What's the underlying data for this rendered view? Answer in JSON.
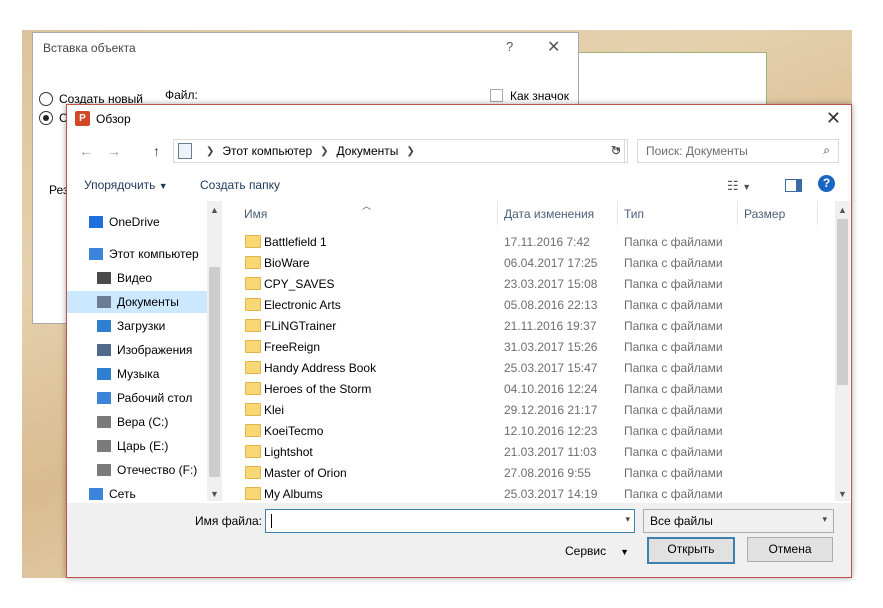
{
  "back_dialog": {
    "title": "Вставка объекта",
    "help": "?",
    "close": "✕",
    "radio_new": "Создать новый",
    "radio_file": "С",
    "file_label": "Файл:",
    "as_icon": "Как значок",
    "group_label": "Рез"
  },
  "dialog": {
    "title": "Обзор",
    "app_icon": "P",
    "close": "✕"
  },
  "nav": {
    "back": "←",
    "forward": "→",
    "up": "↑"
  },
  "address": {
    "crumbs": [
      "Этот компьютер",
      "Документы"
    ]
  },
  "search": {
    "placeholder": "Поиск: Документы"
  },
  "toolbar": {
    "organize": "Упорядочить",
    "new_folder": "Создать папку"
  },
  "sidebar": {
    "items": [
      {
        "label": "OneDrive",
        "icon": "onedrive-icon"
      },
      {
        "label": "Этот компьютер",
        "icon": "computer-icon"
      },
      {
        "label": "Видео",
        "icon": "video-icon"
      },
      {
        "label": "Документы",
        "icon": "documents-icon",
        "selected": true
      },
      {
        "label": "Загрузки",
        "icon": "downloads-icon"
      },
      {
        "label": "Изображения",
        "icon": "pictures-icon"
      },
      {
        "label": "Музыка",
        "icon": "music-icon"
      },
      {
        "label": "Рабочий стол",
        "icon": "desktop-icon"
      },
      {
        "label": "Вера (C:)",
        "icon": "drive-icon"
      },
      {
        "label": "Царь (E:)",
        "icon": "drive-icon"
      },
      {
        "label": "Отечество (F:)",
        "icon": "drive-icon"
      },
      {
        "label": "Сеть",
        "icon": "network-icon"
      }
    ]
  },
  "columns": {
    "name": "Имя",
    "date": "Дата изменения",
    "type": "Тип",
    "size": "Размер"
  },
  "files": [
    {
      "name": "Battlefield 1",
      "date": "17.11.2016 7:42",
      "type": "Папка с файлами"
    },
    {
      "name": "BioWare",
      "date": "06.04.2017 17:25",
      "type": "Папка с файлами"
    },
    {
      "name": "CPY_SAVES",
      "date": "23.03.2017 15:08",
      "type": "Папка с файлами"
    },
    {
      "name": "Electronic Arts",
      "date": "05.08.2016 22:13",
      "type": "Папка с файлами"
    },
    {
      "name": "FLiNGTrainer",
      "date": "21.11.2016 19:37",
      "type": "Папка с файлами"
    },
    {
      "name": "FreeReign",
      "date": "31.03.2017 15:26",
      "type": "Папка с файлами"
    },
    {
      "name": "Handy Address Book",
      "date": "25.03.2017 15:47",
      "type": "Папка с файлами"
    },
    {
      "name": "Heroes of the Storm",
      "date": "04.10.2016 12:24",
      "type": "Папка с файлами"
    },
    {
      "name": "Klei",
      "date": "29.12.2016 21:17",
      "type": "Папка с файлами"
    },
    {
      "name": "KoeiTecmo",
      "date": "12.10.2016 12:23",
      "type": "Папка с файлами"
    },
    {
      "name": "Lightshot",
      "date": "21.03.2017 11:03",
      "type": "Папка с файлами"
    },
    {
      "name": "Master of Orion",
      "date": "27.08.2016 9:55",
      "type": "Папка с файлами"
    },
    {
      "name": "My Albums",
      "date": "25.03.2017 14:19",
      "type": "Папка с файлами"
    }
  ],
  "footer": {
    "filename_label": "Имя файла:",
    "filename_value": "",
    "filter_value": "Все файлы",
    "service": "Сервис",
    "open": "Открыть",
    "cancel": "Отмена"
  },
  "colors": {
    "accent": "#3c7fb1",
    "frame": "#c0504d",
    "selected": "#cce8ff",
    "folder": "#f8d775"
  }
}
